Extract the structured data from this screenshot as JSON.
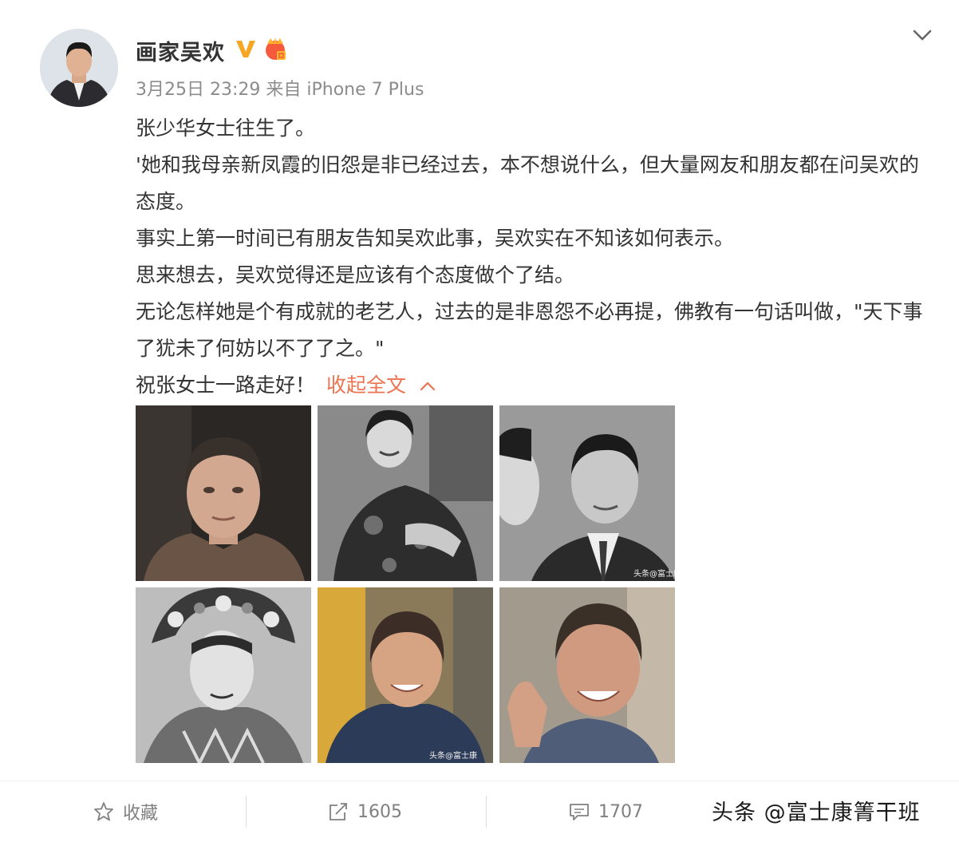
{
  "post": {
    "author": "画家吴欢",
    "meta": "3月25日 23:29 来自 iPhone 7 Plus",
    "paragraphs": [
      "张少华女士往生了。",
      "'她和我母亲新凤霞的旧怨是非已经过去，本不想说什么，但大量网友和朋友都在问吴欢的态度。",
      "事实上第一时间已有朋友告知吴欢此事，吴欢实在不知该如何表示。",
      "思来想去，吴欢觉得还是应该有个态度做个了结。",
      "无论怎样她是个有成就的老艺人，过去的是非恩怨不必再提，佛教有一句话叫做，\"天下事了犹未了何妨以不了了之。\""
    ],
    "last_line": "祝张女士一路走好！",
    "collapse_label": "收起全文",
    "photo_watermarks": [
      "头条@富士康",
      "头条@富士康"
    ]
  },
  "actions": {
    "favorite_label": "收藏",
    "repost_count": "1605",
    "comment_count": "1707"
  },
  "watermark": "头条 @富士康箐干班",
  "colors": {
    "link": "#eb7350",
    "verified": "#f5a623",
    "text": "#333333",
    "meta": "#8c8c8c"
  },
  "icons": {
    "verified": "verified-v-icon",
    "member": "crown-member-icon",
    "menu": "chevron-down-icon",
    "collapse": "chevron-up-icon",
    "favorite": "star-icon",
    "repost": "share-icon",
    "comment": "comment-icon"
  }
}
